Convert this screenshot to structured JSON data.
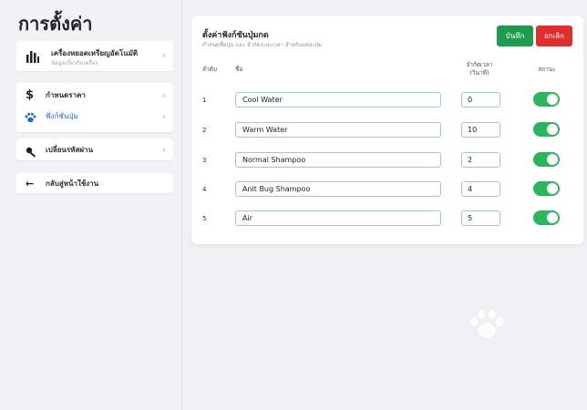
{
  "sidebar": {
    "title": "การตั้งค่า",
    "device": {
      "label": "เครื่องหยอดเหรียญอัตโนมัติ",
      "sub": "ข้อมูลเกี่ยวกับเครื่อง"
    },
    "items": [
      {
        "label": "กำหนดราคา"
      },
      {
        "label": "ฟังก์ชันปุ่ม"
      },
      {
        "label": "เปลี่ยนรหัสผ่าน"
      },
      {
        "label": "กลับสู่หน้าใช้งาน"
      }
    ]
  },
  "main": {
    "title": "ตั้งค่าฟังก์ชันปุ่มกด",
    "subtitle": "กำหนดชื่อปุ่ม และ จำกัดระยะเวลา สำหรับแต่ละปุ่ม",
    "save_label": "บันทึก",
    "cancel_label": "ยกเลิก",
    "columns": {
      "order": "ลำดับ",
      "name": "ชื่อ",
      "duration": "จำกัดเวลา (วินาที)",
      "status": "สถานะ"
    },
    "rows": [
      {
        "order": "1",
        "name": "Cool Water",
        "duration": "0",
        "enabled": true
      },
      {
        "order": "2",
        "name": "Warm Water",
        "duration": "10",
        "enabled": true
      },
      {
        "order": "3",
        "name": "Normal Shampoo",
        "duration": "2",
        "enabled": true
      },
      {
        "order": "4",
        "name": "Anit Bug Shampoo",
        "duration": "4",
        "enabled": true
      },
      {
        "order": "5",
        "name": "Air",
        "duration": "5",
        "enabled": true
      }
    ]
  },
  "colors": {
    "accent": "#2bb55c",
    "save": "#1d9b4e",
    "cancel": "#e12d2d",
    "paw": "#2563eb"
  }
}
